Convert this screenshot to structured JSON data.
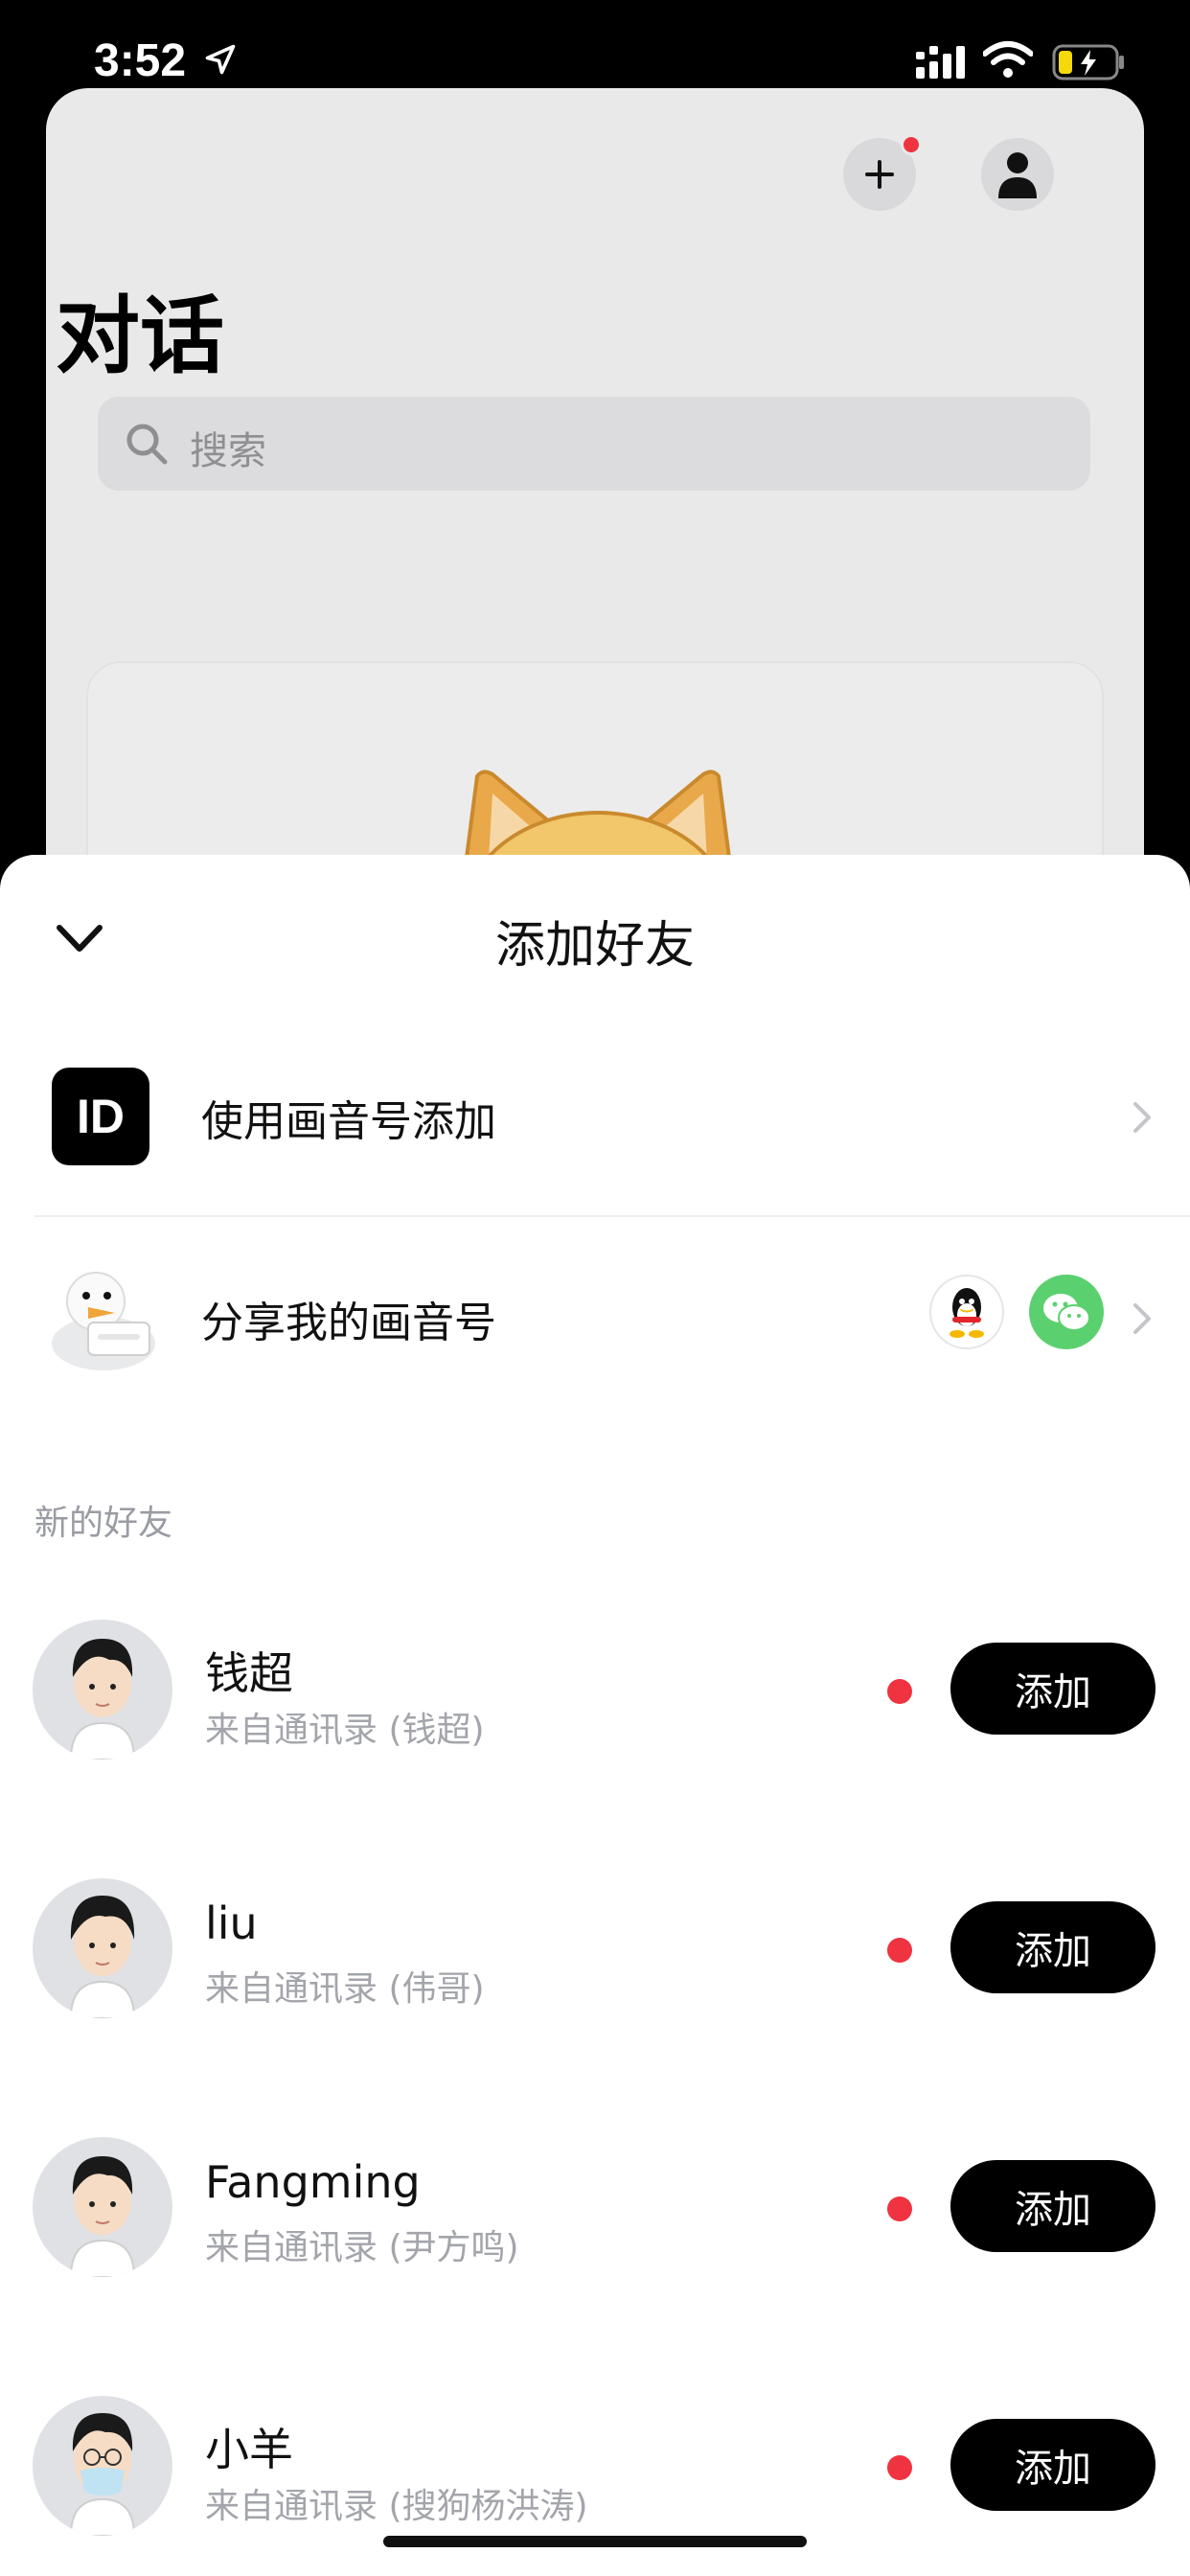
{
  "status_bar": {
    "time": "3:52"
  },
  "background": {
    "title": "对话",
    "search_placeholder": "搜索"
  },
  "sheet": {
    "title": "添加好友",
    "options": [
      {
        "icon_text": "ID",
        "label": "使用画音号添加"
      },
      {
        "label": "分享我的画音号"
      }
    ],
    "section_label": "新的好友",
    "friends": [
      {
        "name": "钱超",
        "source": "来自通讯录 (钱超)",
        "button": "添加"
      },
      {
        "name": "liu",
        "source": "来自通讯录 (伟哥)",
        "button": "添加"
      },
      {
        "name": "Fangming",
        "source": "来自通讯录 (尹方鸣)",
        "button": "添加"
      },
      {
        "name": "小羊",
        "source": "来自通讯录 (搜狗杨洪涛)",
        "button": "添加"
      }
    ]
  },
  "colors": {
    "accent_dot": "#ef3340",
    "wechat_green": "#5ad16e",
    "button_bg": "#000000"
  },
  "icons": [
    "location-arrow-icon",
    "signal-icon",
    "wifi-icon",
    "battery-icon",
    "plus-icon",
    "user-icon",
    "search-icon",
    "chevron-down-icon",
    "chevron-right-icon",
    "qq-icon",
    "wechat-icon"
  ]
}
